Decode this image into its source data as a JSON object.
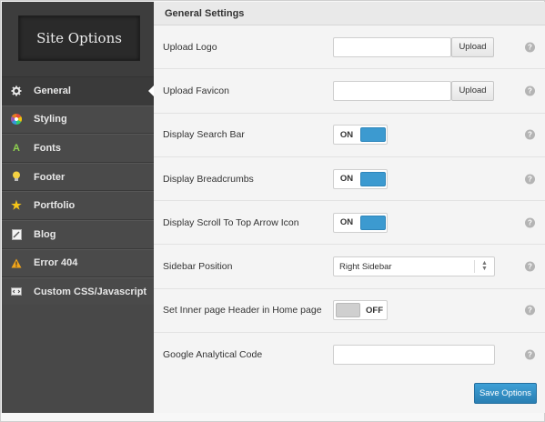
{
  "logo": {
    "text": "Site Options"
  },
  "sidebar": {
    "items": [
      {
        "label": "General",
        "icon": "gear-icon",
        "active": true
      },
      {
        "label": "Styling",
        "icon": "color-wheel-icon"
      },
      {
        "label": "Fonts",
        "icon": "font-icon"
      },
      {
        "label": "Footer",
        "icon": "lightbulb-icon"
      },
      {
        "label": "Portfolio",
        "icon": "star-icon"
      },
      {
        "label": "Blog",
        "icon": "document-icon"
      },
      {
        "label": "Error 404",
        "icon": "warning-icon"
      },
      {
        "label": "Custom CSS/Javascript",
        "icon": "code-icon"
      }
    ]
  },
  "main": {
    "title": "General Settings",
    "rows": [
      {
        "label": "Upload Logo",
        "type": "upload",
        "button": "Upload",
        "value": ""
      },
      {
        "label": "Upload Favicon",
        "type": "upload",
        "button": "Upload",
        "value": ""
      },
      {
        "label": "Display Search Bar",
        "type": "toggle",
        "state": "ON"
      },
      {
        "label": "Display Breadcrumbs",
        "type": "toggle",
        "state": "ON"
      },
      {
        "label": "Display Scroll To Top Arrow Icon",
        "type": "toggle",
        "state": "ON"
      },
      {
        "label": "Sidebar Position",
        "type": "select",
        "value": "Right Sidebar"
      },
      {
        "label": "Set Inner page Header in Home page",
        "type": "toggle",
        "state": "OFF"
      },
      {
        "label": "Google Analytical Code",
        "type": "text",
        "value": ""
      }
    ],
    "help_glyph": "?",
    "save_label": "Save Options"
  },
  "colors": {
    "sidebar_bg": "#4a4a4a",
    "accent": "#3c9ad0",
    "help": "#b4b4b4"
  }
}
